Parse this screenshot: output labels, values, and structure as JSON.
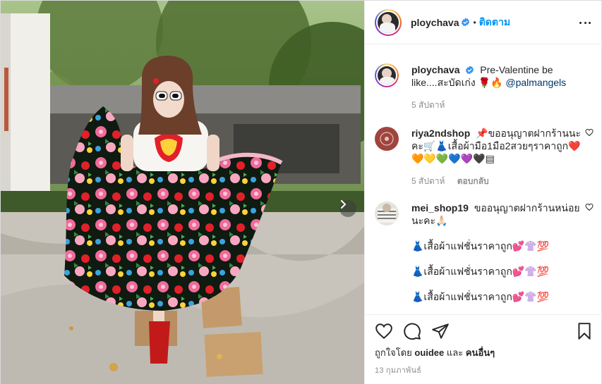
{
  "post": {
    "username": "ploychava",
    "follow_label": "ติดตาม",
    "dot": "•"
  },
  "caption": {
    "username": "ploychava",
    "text": "Pre-Valentine be like....สะบัดเก่ง 🌹🔥",
    "mention": "@palmangels",
    "time": "5 สัปดาห์"
  },
  "comments": [
    {
      "username": "riya2ndshop",
      "text_line1": "📌ขออนุญาตฝากร้านนะคะ🛒👗เสื้อผ้ามือ1มือ2สวยๆราคาถูก❤️",
      "text_line2": "🧡💛💚💙💜🖤▤",
      "time": "5 สัปดาห์",
      "reply_label": "ตอบกลับ"
    },
    {
      "username": "mei_shop19",
      "text": "ขออนุญาตฝากร้านหน่อยนะคะ🙏🏻",
      "lines": [
        "👗เสื้อผ้าแฟชั่นราคาถูก💕👚💯",
        "👗เสื้อผ้าแฟชั่นราคาถูก💕👚💯",
        "👗เสื้อผ้าแฟชั่นราคาถูก💕👚💯"
      ]
    }
  ],
  "likes": {
    "prefix": "ถูกใจโดย",
    "user": "ouidee",
    "joiner": "และ",
    "others": "คนอื่นๆ"
  },
  "date": "13 กุมภาพันธ์",
  "icons": {
    "verified": "verified-badge-icon",
    "more": "more-options-icon",
    "like": "heart-icon",
    "comment": "comment-icon",
    "share": "share-icon",
    "save": "bookmark-icon",
    "next": "chevron-right-icon"
  },
  "colors": {
    "accent": "#0095f6",
    "text": "#262626",
    "muted": "#8e8e8e",
    "border": "#dbdbdb"
  }
}
